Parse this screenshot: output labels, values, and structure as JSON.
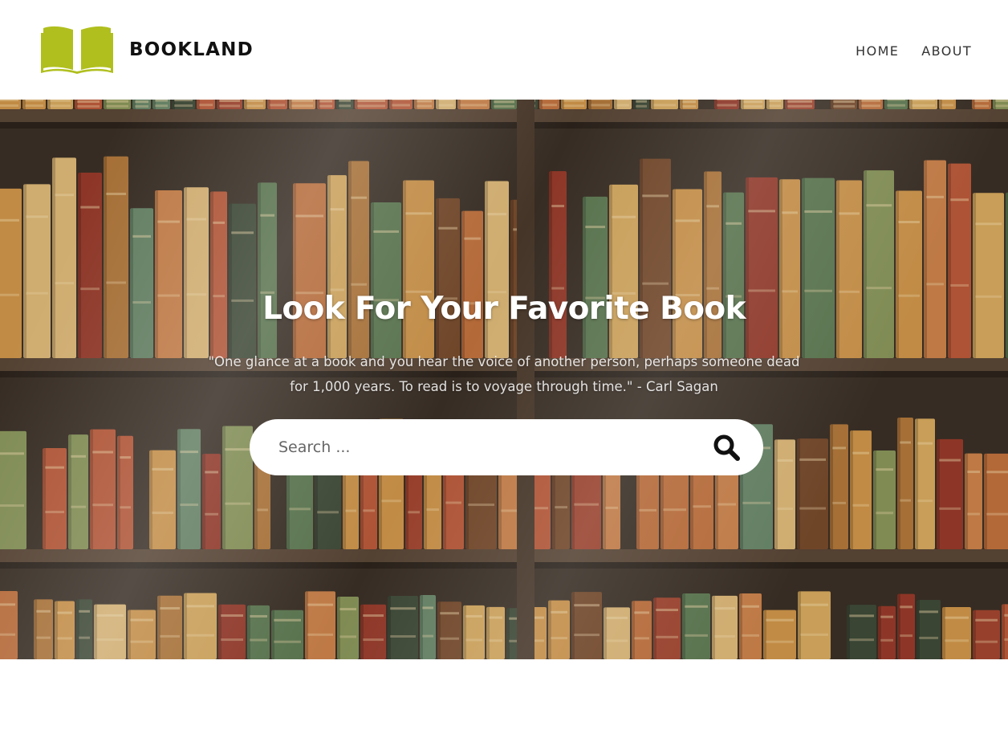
{
  "brand": {
    "name": "BOOKLAND",
    "logo_icon": "open-book-icon",
    "logo_color": "#b0bf1e"
  },
  "nav": {
    "items": [
      {
        "label": "HOME"
      },
      {
        "label": "ABOUT"
      }
    ]
  },
  "hero": {
    "background": "bookshelf-photo",
    "title": "Look For Your Favorite Book",
    "quote": "\"One glance at a book and you hear the voice of another person, perhaps someone dead for 1,000 years. To read is to voyage through time.\" - Carl Sagan"
  },
  "search": {
    "placeholder": "Search ...",
    "value": "",
    "button_icon": "search-icon"
  }
}
